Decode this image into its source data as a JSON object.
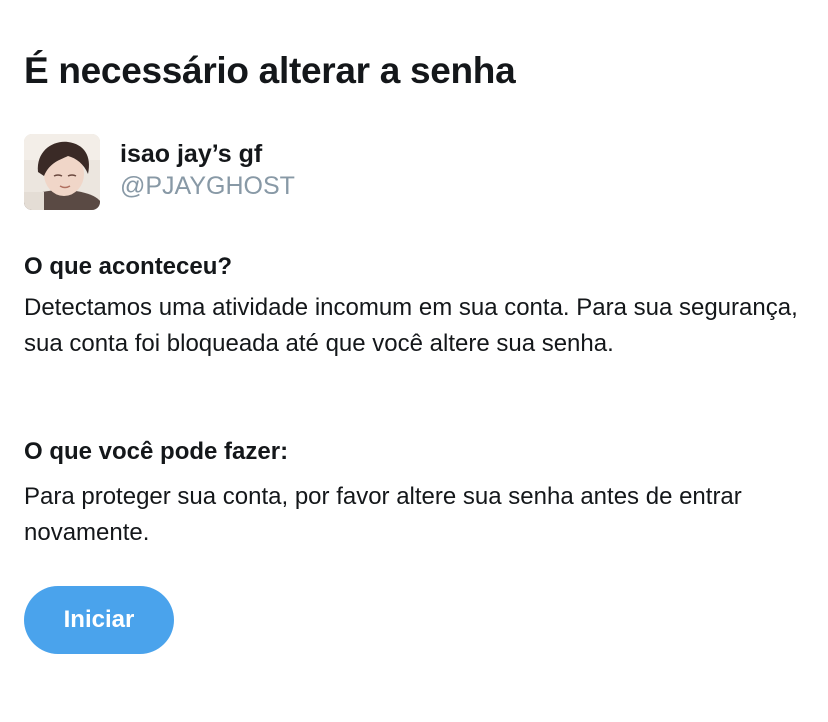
{
  "title": "É necessário alterar a senha",
  "profile": {
    "display_name": "isao jay’s gf",
    "handle": "@PJAYGHOST"
  },
  "what_happened": {
    "heading": "O que aconteceu?",
    "body": "Detectamos uma atividade incomum em sua conta. Para sua segurança, sua conta foi bloqueada até que você altere sua senha."
  },
  "what_to_do": {
    "heading": "O que você pode fazer:",
    "body": "Para proteger sua conta, por favor altere sua senha antes de entrar novamente."
  },
  "button": {
    "label": "Iniciar"
  },
  "colors": {
    "accent": "#4aa3ec",
    "text": "#14171a",
    "secondary_text": "#8899a6"
  }
}
